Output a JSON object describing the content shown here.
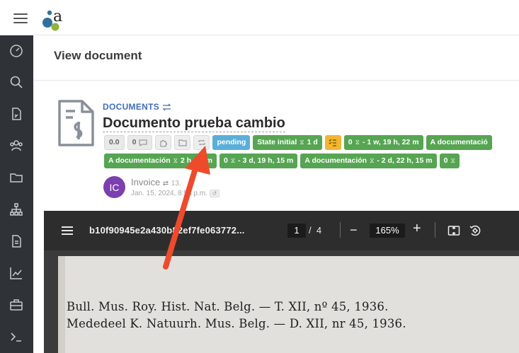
{
  "header": {
    "page_title": "View document"
  },
  "document": {
    "type_label": "DOCUMENTS",
    "title": "Documento prueba cambio"
  },
  "chips_row1": {
    "version": "0.0",
    "comments": "0",
    "status": "pending",
    "state": "State initial",
    "state_time": "1 d",
    "task_count": "0",
    "task_time": "- 1 w, 19 h, 22 m",
    "assigned": "A documentació"
  },
  "chips_row2": {
    "chip1_label": "A documentación",
    "chip1_time": "2 h, 55 m",
    "chip2_count": "0",
    "chip2_time": "- 3 d, 19 h, 15 m",
    "chip3_label": "A documentación",
    "chip3_time": "- 2 d, 22 h, 15 m",
    "chip4_count": "0"
  },
  "linked": {
    "avatar_initials": "IC",
    "name": "Invoice",
    "extra": "13.",
    "date": "Jan. 15, 2024, 8:58 p.m."
  },
  "viewer": {
    "filename": "b10f90945e2a430b82ef7fe063772...",
    "page": "1",
    "total_pages": "4",
    "zoom": "165%",
    "line1": "Bull. Mus. Roy. Hist. Nat. Belg. — T. XII, nº 45, 1936.",
    "line2": "Mededeel K. Natuurh. Mus. Belg. — D. XII, nr 45, 1936."
  },
  "colors": {
    "sidebar": "#2f3338",
    "accent_blue": "#3f6fb5",
    "chip_green": "#56a552",
    "chip_blue": "#5aafda",
    "chip_yellow": "#f2b630",
    "annotation_arrow": "#ee4a2c"
  }
}
